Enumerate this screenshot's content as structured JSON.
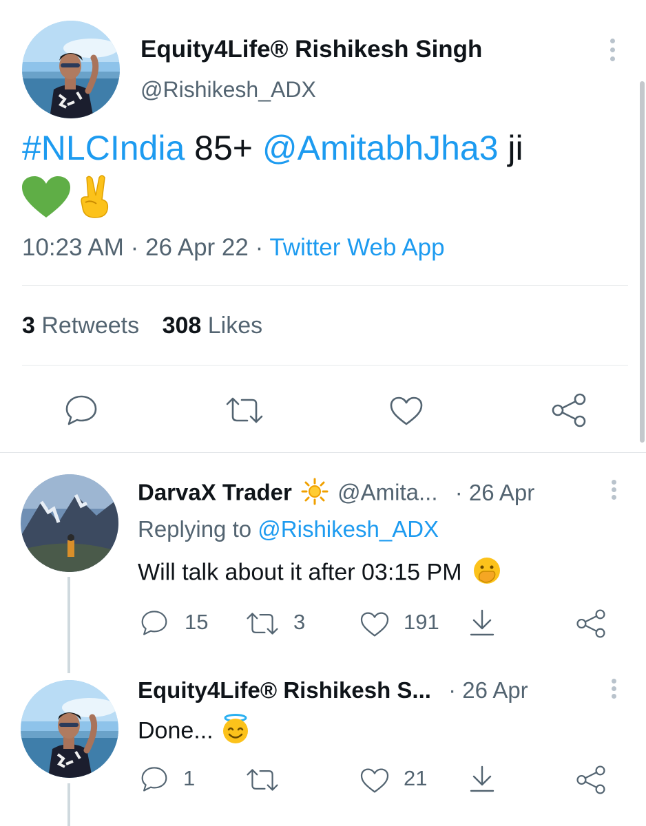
{
  "tweet": {
    "author_name": "Equity4Life® Rishikesh Singh",
    "author_handle": "@Rishikesh_ADX",
    "hashtag": "#NLCIndia",
    "text_mid": "85+",
    "mention": "@AmitabhJha3",
    "text_end": "ji",
    "time": "10:23 AM",
    "date": "26 Apr 22",
    "source": "Twitter Web App",
    "sep": "·",
    "retweets_count": "3",
    "retweets_label": "Retweets",
    "likes_count": "308",
    "likes_label": "Likes"
  },
  "replies": [
    {
      "author_name": "DarvaX Trader",
      "author_handle": "@Amita...",
      "time_ago": "· 26 Apr",
      "replying_prefix": "Replying to",
      "replying_to": "@Rishikesh_ADX",
      "text": "Will talk about it after 03:15 PM",
      "reply_count": "15",
      "retweet_count": "3",
      "like_count": "191"
    },
    {
      "author_name": "Equity4Life® Rishikesh S...",
      "time_ago": "· 26 Apr",
      "text": "Done...",
      "reply_count": "1",
      "retweet_count": "",
      "like_count": "21"
    }
  ],
  "colors": {
    "accent": "#1d9bf0",
    "text": "#0f1419",
    "muted": "#536471",
    "heart_green": "#5fae46"
  },
  "icons": [
    "more-icon",
    "reply-icon",
    "retweet-icon",
    "like-icon",
    "share-icon",
    "download-icon"
  ]
}
